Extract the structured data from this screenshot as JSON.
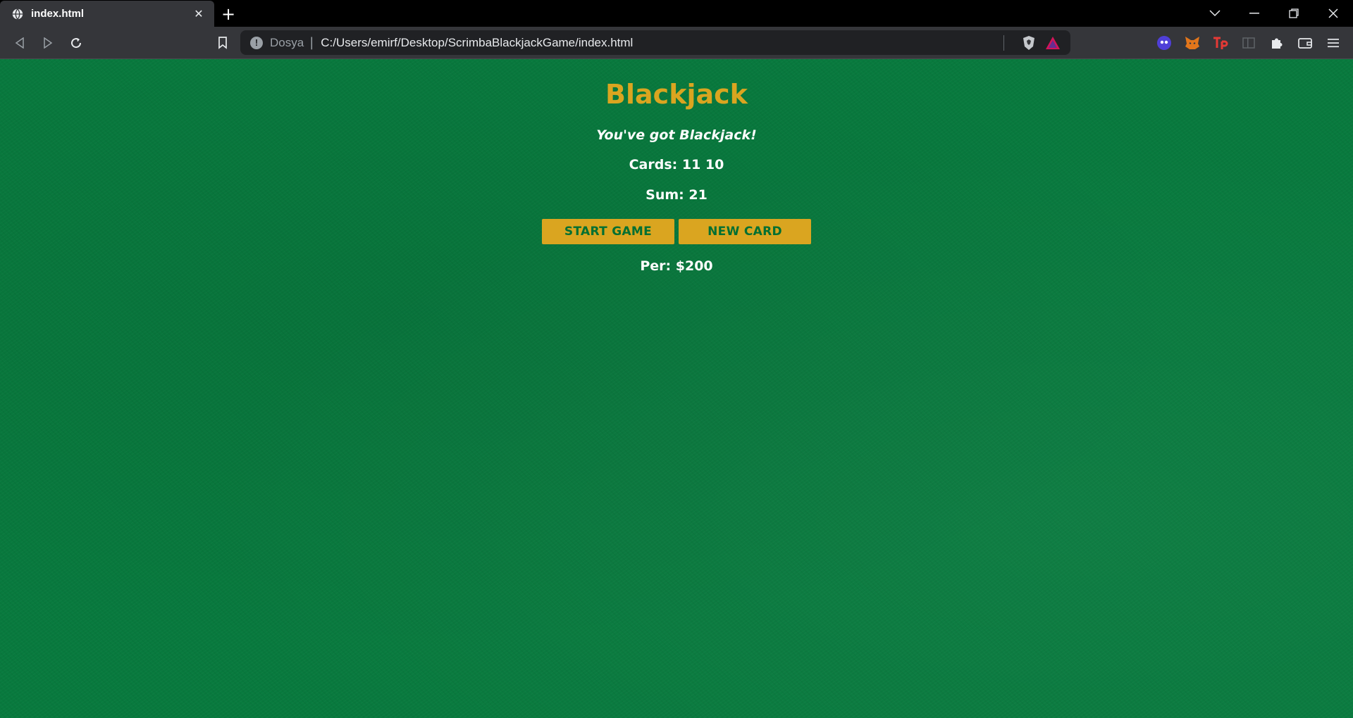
{
  "browser": {
    "tab": {
      "title": "index.html",
      "close_symbol": "✕",
      "icon": "globe-icon"
    },
    "new_tab_symbol": "+",
    "window_controls": [
      "chevron-down-icon",
      "minimize-icon",
      "restore-icon",
      "close-icon"
    ],
    "address_bar": {
      "scheme_label": "Dosya",
      "separator": "|",
      "url": "C:/Users/emirf/Desktop/ScrimbaBlackjackGame/index.html",
      "info_symbol": "!"
    },
    "extensions": [
      "brave-shield-icon",
      "brave-rewards-icon",
      "ghost-extension-icon",
      "metamask-icon",
      "tp-extension-icon",
      "sidebar-icon",
      "puzzle-icon",
      "wallet-icon",
      "menu-icon"
    ]
  },
  "game": {
    "title": "Blackjack",
    "message": "You've got Blackjack!",
    "cards_text": "Cards: 11 10",
    "sum_text": "Sum: 21",
    "start_button_label": "START GAME",
    "new_card_button_label": "NEW CARD",
    "player_text": "Per: $200"
  },
  "colors": {
    "felt_green": "#087a3e",
    "accent_gold": "#daa520",
    "button_text": "#016f32",
    "text_white": "#ffffff"
  }
}
